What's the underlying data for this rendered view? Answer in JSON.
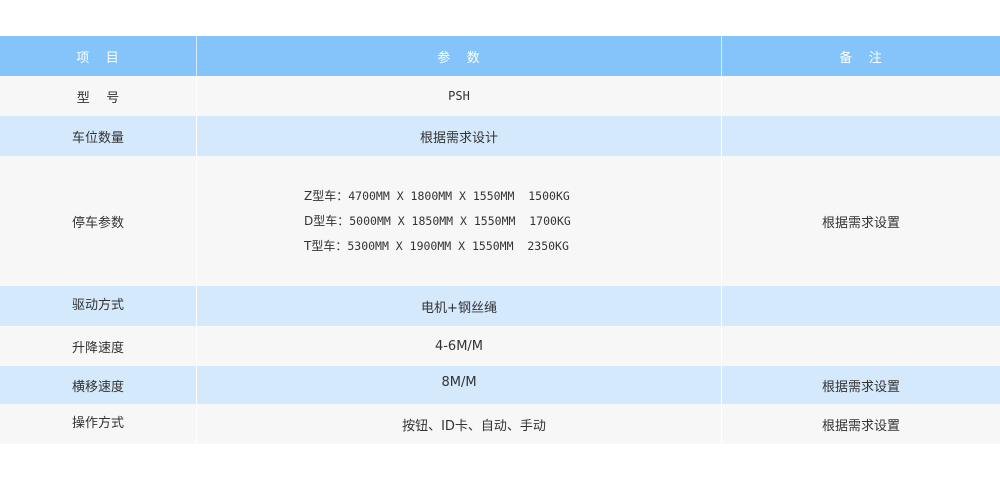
{
  "table": {
    "headers": {
      "item": "项   目",
      "param": "参   数",
      "note": "备   注"
    },
    "rows": [
      {
        "item": "型    号",
        "param": "PSH",
        "note": ""
      },
      {
        "item": "车位数量",
        "param": "根据需求设计",
        "note": ""
      },
      {
        "item": "停车参数",
        "param_lines": [
          {
            "label": "Z型车：",
            "spec": "4700MM X 1800MM X 1550MM  1500KG"
          },
          {
            "label": "D型车：",
            "spec": "5000MM X 1850MM X 1550MM  1700KG"
          },
          {
            "label": "T型车：",
            "spec": "5300MM X 1900MM X 1550MM  2350KG"
          }
        ],
        "note": "根据需求设置"
      },
      {
        "item": "驱动方式",
        "param": "电机+钢丝绳",
        "note": ""
      },
      {
        "item": "升降速度",
        "param": "4-6M/M",
        "note": ""
      },
      {
        "item": "横移速度",
        "param": "8M/M",
        "note": "根据需求设置"
      },
      {
        "item": "操作方式",
        "param": "按钮、ID卡、自动、手动",
        "note": "根据需求设置"
      }
    ]
  },
  "colors": {
    "header_bg": "#84c4fb",
    "row_light": "#f7f7f7",
    "row_blue": "#d5e9fc",
    "text": "#333333"
  }
}
